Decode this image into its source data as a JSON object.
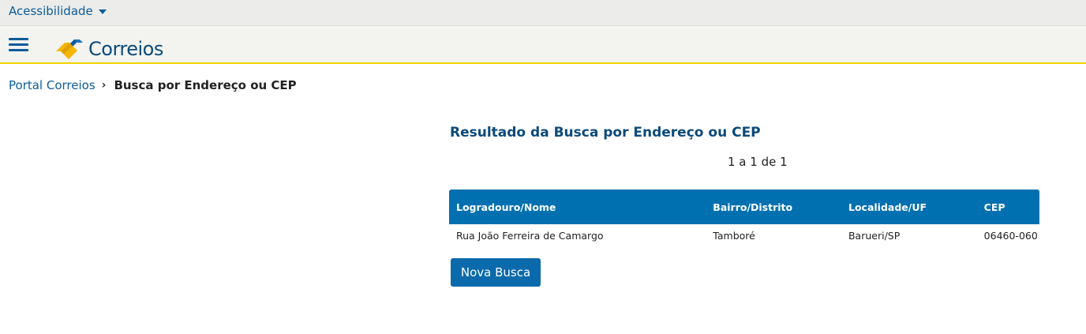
{
  "topbar": {
    "accessibility_label": "Acessibilidade"
  },
  "header": {
    "logo_text": "Correios"
  },
  "breadcrumb": {
    "home": "Portal Correios",
    "current": "Busca por Endereço ou CEP"
  },
  "result": {
    "title": "Resultado da Busca por Endereço ou CEP",
    "pagination": "1 a 1 de 1",
    "columns": [
      "Logradouro/Nome",
      "Bairro/Distrito",
      "Localidade/UF",
      "CEP"
    ],
    "rows": [
      [
        "Rua João Ferreira de Camargo",
        "Tamboré",
        "Barueri/SP",
        "06460-060"
      ]
    ],
    "new_search_label": "Nova Busca"
  },
  "colors": {
    "primary_blue": "#0a5c99",
    "table_header": "#0070b0",
    "logo_yellow": "#f5b700",
    "header_accent": "#f2d400"
  },
  "icons": [
    "menu-icon",
    "caret-down-icon",
    "chevron-right-icon",
    "correios-logo"
  ]
}
